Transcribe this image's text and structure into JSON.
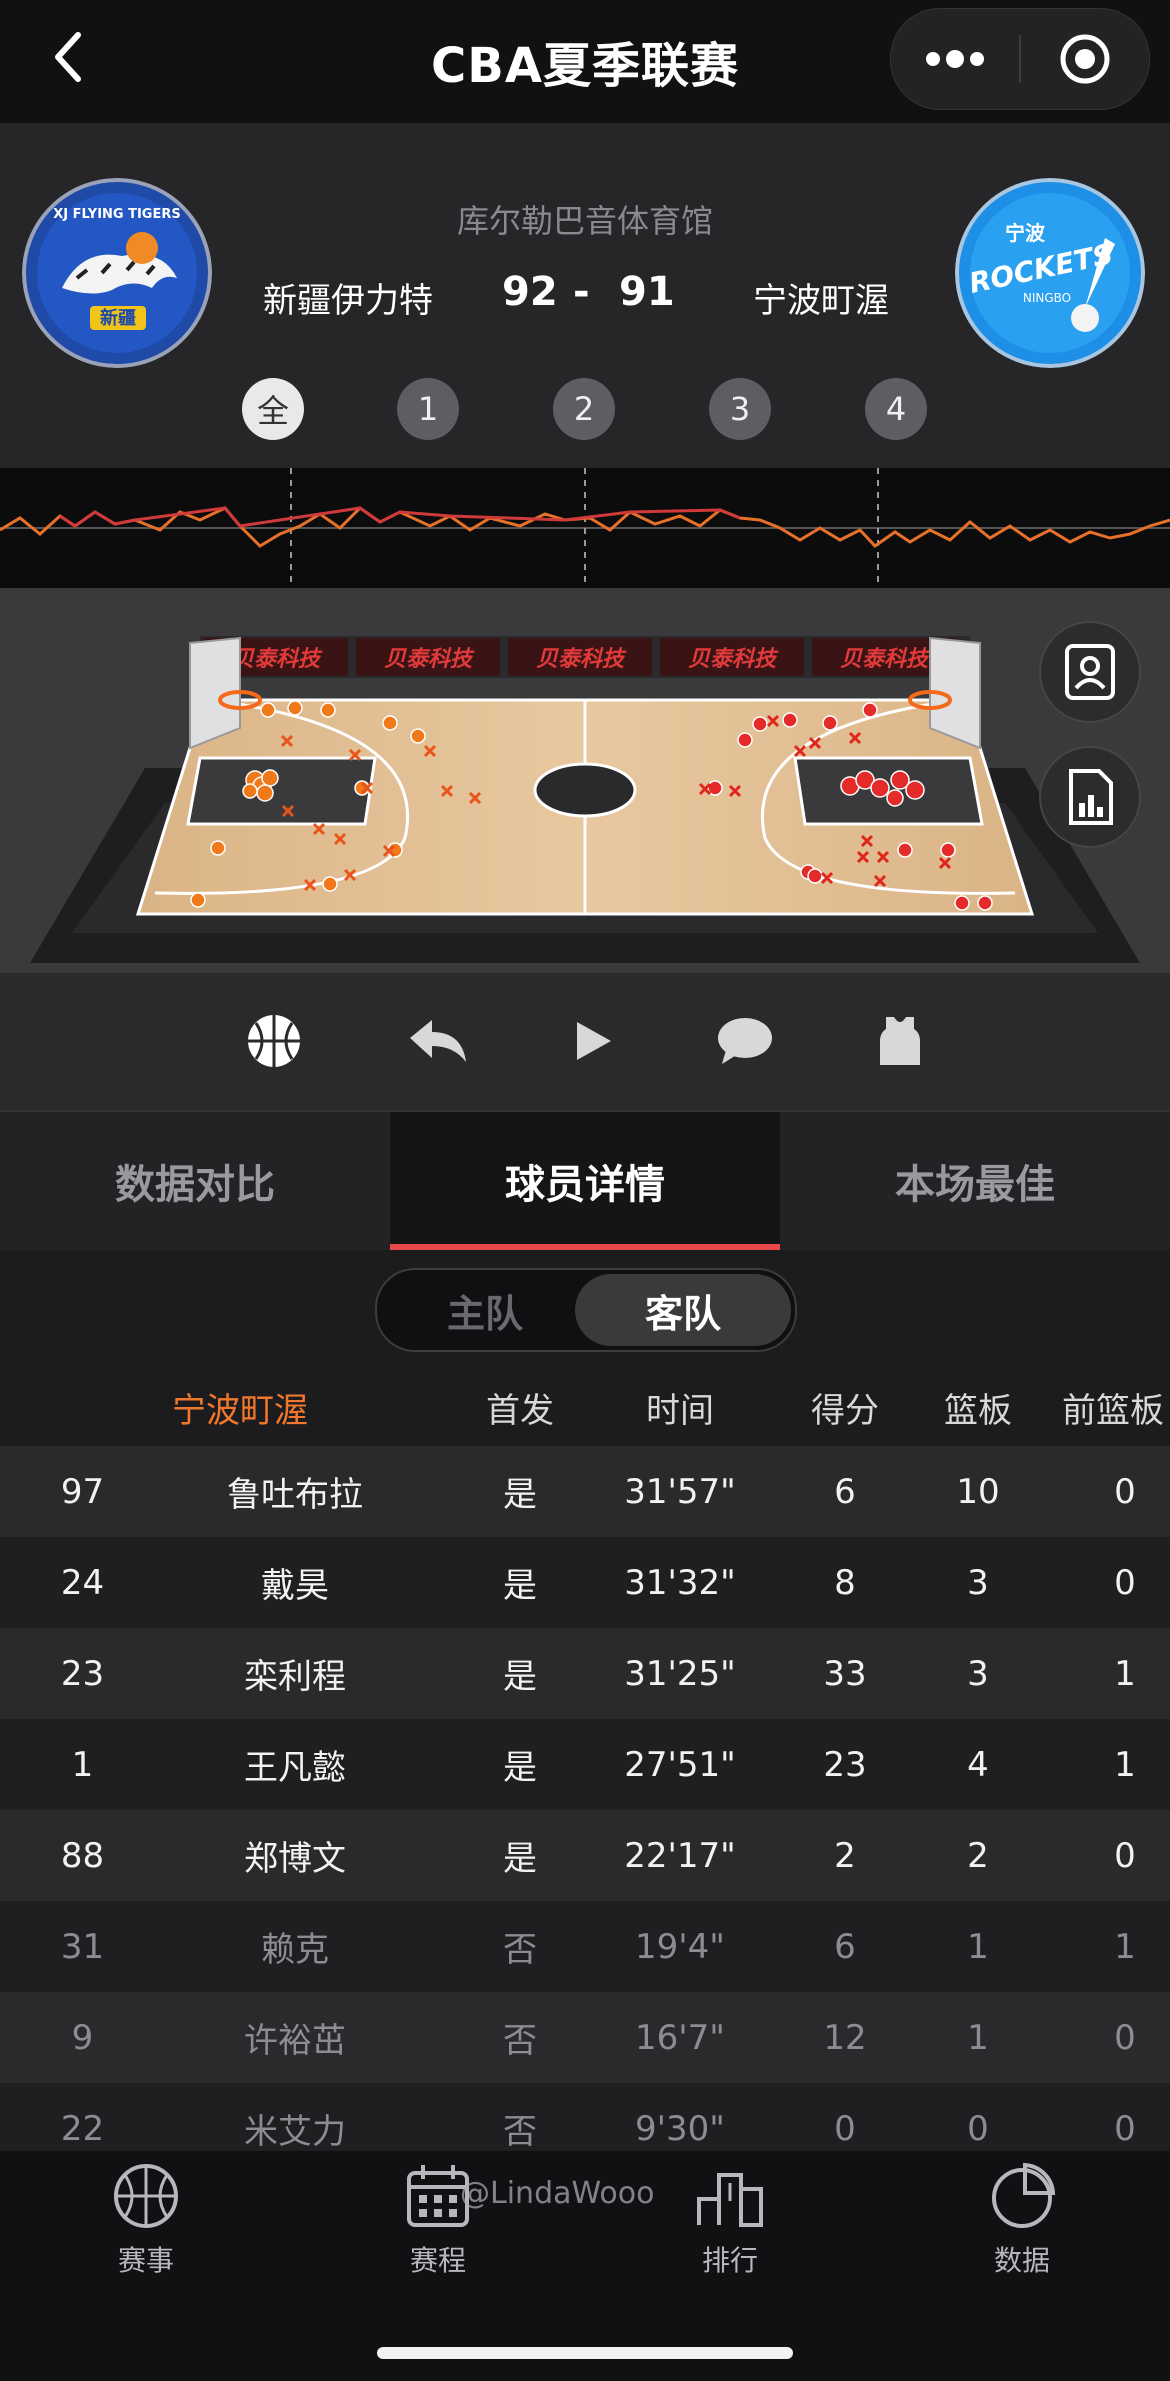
{
  "topbar": {
    "title": "CBA夏季联赛"
  },
  "match": {
    "venue": "库尔勒巴音体育馆",
    "home_team": "新疆伊力特",
    "away_team": "宁波町渥",
    "home_score": "92",
    "separator": "-",
    "away_score": "91",
    "home_logo_text": "新疆",
    "home_logo_arc": "XJ FLYING TIGERS",
    "away_logo_text": "ROCKETS",
    "away_logo_cn": "宁波",
    "away_logo_sub": "NINGBO"
  },
  "quarters": [
    {
      "label": "全",
      "active": true
    },
    {
      "label": "1",
      "active": false
    },
    {
      "label": "2",
      "active": false
    },
    {
      "label": "3",
      "active": false
    },
    {
      "label": "4",
      "active": false
    }
  ],
  "court": {
    "sponsor": "贝泰科技",
    "home_color": "#f07a1a",
    "away_color": "#e52a2a"
  },
  "toolbar_icons": [
    "basketball-icon",
    "undo-icon",
    "play-icon",
    "comment-icon",
    "jersey-icon"
  ],
  "side_icons": [
    "player-card-icon",
    "stats-chart-icon"
  ],
  "tabs": [
    {
      "label": "数据对比",
      "active": false
    },
    {
      "label": "球员详情",
      "active": true
    },
    {
      "label": "本场最佳",
      "active": false
    }
  ],
  "segment": {
    "home": "主队",
    "away": "客队",
    "selected": "away"
  },
  "table": {
    "headers": [
      "宁波町渥",
      "首发",
      "时间",
      "得分",
      "篮板",
      "前篮板"
    ],
    "rows": [
      {
        "num": "97",
        "name": "鲁吐布拉",
        "starter": "是",
        "time": "31'57\"",
        "pts": "6",
        "reb": "10",
        "oreb": "0"
      },
      {
        "num": "24",
        "name": "戴昊",
        "starter": "是",
        "time": "31'32\"",
        "pts": "8",
        "reb": "3",
        "oreb": "0"
      },
      {
        "num": "23",
        "name": "栾利程",
        "starter": "是",
        "time": "31'25\"",
        "pts": "33",
        "reb": "3",
        "oreb": "1"
      },
      {
        "num": "1",
        "name": "王凡懿",
        "starter": "是",
        "time": "27'51\"",
        "pts": "23",
        "reb": "4",
        "oreb": "1"
      },
      {
        "num": "88",
        "name": "郑博文",
        "starter": "是",
        "time": "22'17\"",
        "pts": "2",
        "reb": "2",
        "oreb": "0"
      },
      {
        "num": "31",
        "name": "赖克",
        "starter": "否",
        "time": "19'4\"",
        "pts": "6",
        "reb": "1",
        "oreb": "1"
      },
      {
        "num": "9",
        "name": "许裕茁",
        "starter": "否",
        "time": "16'7\"",
        "pts": "12",
        "reb": "1",
        "oreb": "0"
      },
      {
        "num": "22",
        "name": "米艾力",
        "starter": "否",
        "time": "9'30\"",
        "pts": "0",
        "reb": "0",
        "oreb": "0"
      }
    ]
  },
  "bottom_nav": [
    {
      "label": "赛事",
      "icon": "basketball-outline-icon"
    },
    {
      "label": "赛程",
      "icon": "calendar-icon"
    },
    {
      "label": "排行",
      "icon": "ranking-icon"
    },
    {
      "label": "数据",
      "icon": "pie-chart-icon"
    }
  ],
  "watermark": "@LindaWooo"
}
